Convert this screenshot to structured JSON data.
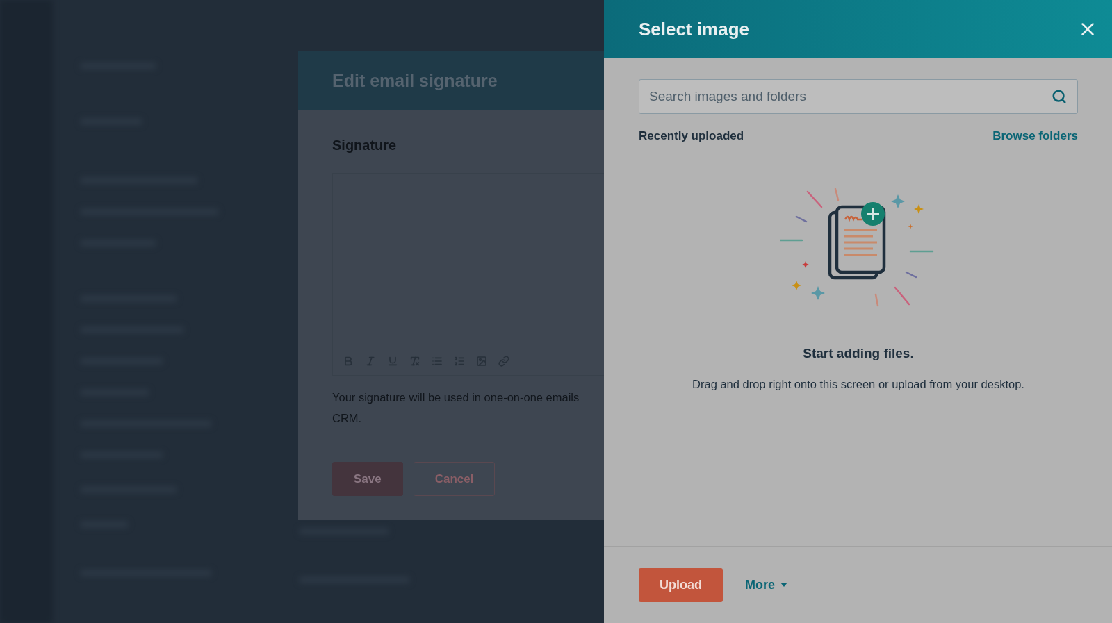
{
  "modal": {
    "title": "Edit email signature",
    "field_label": "Signature",
    "help_text": [
      "Your signature will be used in one-on-one emails",
      "CRM."
    ],
    "buttons": [
      {
        "label": "Save",
        "kind": "primary"
      },
      {
        "label": "Cancel",
        "kind": "secondary"
      }
    ]
  },
  "panel": {
    "title": "Select image",
    "search": {
      "placeholder": "Search images and folders"
    },
    "section_title": "Recently uploaded",
    "browse_link": "Browse folders",
    "empty_state": {
      "title": "Start adding files.",
      "description": "Drag and drop right onto this screen or upload from your desktop."
    },
    "footer_buttons": [
      {
        "label": "Upload",
        "kind": "primary"
      },
      {
        "label": "More",
        "kind": "dropdown"
      }
    ]
  }
}
